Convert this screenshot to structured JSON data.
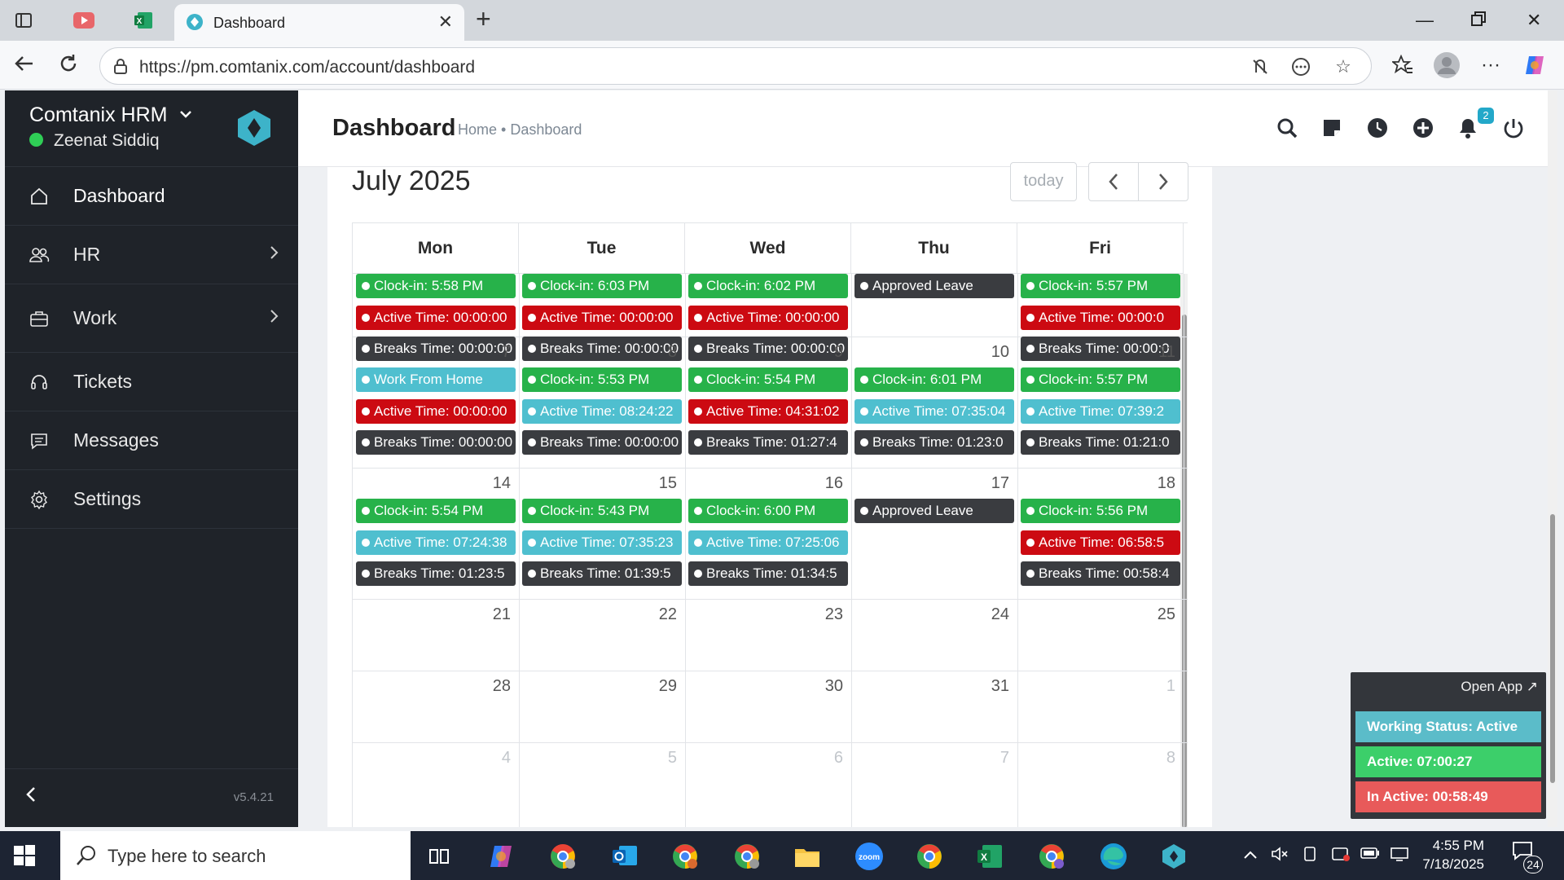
{
  "browser": {
    "tab_title": "Dashboard",
    "url": "https://pm.comtanix.com/account/dashboard"
  },
  "sidebar": {
    "brand": "Comtanix HRM",
    "user": "Zeenat Siddiq",
    "items": [
      {
        "label": "Dashboard",
        "icon": "home-icon"
      },
      {
        "label": "HR",
        "icon": "users-icon"
      },
      {
        "label": "Work",
        "icon": "briefcase-icon"
      },
      {
        "label": "Tickets",
        "icon": "headset-icon"
      },
      {
        "label": "Messages",
        "icon": "message-icon"
      },
      {
        "label": "Settings",
        "icon": "gear-icon"
      }
    ],
    "version": "v5.4.21"
  },
  "header": {
    "title": "Dashboard",
    "breadcrumb": [
      "Home",
      "Dashboard"
    ],
    "notification_count": "2"
  },
  "calendar": {
    "month_title": "July 2025",
    "today_label": "today",
    "days": [
      "Mon",
      "Tue",
      "Wed",
      "Thu",
      "Fri"
    ],
    "weeks": [
      {
        "nums": [
          "",
          "",
          "",
          "",
          ""
        ],
        "events": [
          [
            {
              "t": "Clock-in: 5:58 PM",
              "c": "green"
            },
            {
              "t": "Active Time: 00:00:00",
              "c": "red"
            },
            {
              "t": "Breaks Time: 00:00:00",
              "c": "dark"
            }
          ],
          [
            {
              "t": "Clock-in: 6:03 PM",
              "c": "green"
            },
            {
              "t": "Active Time: 00:00:00",
              "c": "red"
            },
            {
              "t": "Breaks Time: 00:00:00",
              "c": "dark"
            }
          ],
          [
            {
              "t": "Clock-in: 6:02 PM",
              "c": "green"
            },
            {
              "t": "Active Time: 00:00:00",
              "c": "red"
            },
            {
              "t": "Breaks Time: 00:00:00",
              "c": "dark"
            }
          ],
          [
            {
              "t": "Approved Leave",
              "c": "dark"
            }
          ],
          [
            {
              "t": "Clock-in: 5:57 PM",
              "c": "green"
            },
            {
              "t": "Active Time: 00:00:0",
              "c": "red"
            },
            {
              "t": "Breaks Time: 00:00:0",
              "c": "dark"
            }
          ]
        ]
      },
      {
        "nums": [
          "7",
          "8",
          "9",
          "10",
          "11"
        ],
        "events": [
          [
            {
              "t": "Work From Home",
              "c": "teal"
            },
            {
              "t": "Active Time: 00:00:00",
              "c": "red"
            },
            {
              "t": "Breaks Time: 00:00:00",
              "c": "dark"
            }
          ],
          [
            {
              "t": "Clock-in: 5:53 PM",
              "c": "green"
            },
            {
              "t": "Active Time: 08:24:22",
              "c": "teal"
            },
            {
              "t": "Breaks Time: 00:00:00",
              "c": "dark"
            }
          ],
          [
            {
              "t": "Clock-in: 5:54 PM",
              "c": "green"
            },
            {
              "t": "Active Time: 04:31:02",
              "c": "red"
            },
            {
              "t": "Breaks Time: 01:27:4",
              "c": "dark"
            }
          ],
          [
            {
              "t": "Clock-in: 6:01 PM",
              "c": "green"
            },
            {
              "t": "Active Time: 07:35:04",
              "c": "teal"
            },
            {
              "t": "Breaks Time: 01:23:0",
              "c": "dark"
            }
          ],
          [
            {
              "t": "Clock-in: 5:57 PM",
              "c": "green"
            },
            {
              "t": "Active Time: 07:39:2",
              "c": "teal"
            },
            {
              "t": "Breaks Time: 01:21:0",
              "c": "dark"
            }
          ]
        ]
      },
      {
        "nums": [
          "14",
          "15",
          "16",
          "17",
          "18"
        ],
        "events": [
          [
            {
              "t": "Clock-in: 5:54 PM",
              "c": "green"
            },
            {
              "t": "Active Time: 07:24:38",
              "c": "teal"
            },
            {
              "t": "Breaks Time: 01:23:5",
              "c": "dark"
            }
          ],
          [
            {
              "t": "Clock-in: 5:43 PM",
              "c": "green"
            },
            {
              "t": "Active Time: 07:35:23",
              "c": "teal"
            },
            {
              "t": "Breaks Time: 01:39:5",
              "c": "dark"
            }
          ],
          [
            {
              "t": "Clock-in: 6:00 PM",
              "c": "green"
            },
            {
              "t": "Active Time: 07:25:06",
              "c": "teal"
            },
            {
              "t": "Breaks Time: 01:34:5",
              "c": "dark"
            }
          ],
          [
            {
              "t": "Approved Leave",
              "c": "dark"
            }
          ],
          [
            {
              "t": "Clock-in: 5:56 PM",
              "c": "green"
            },
            {
              "t": "Active Time: 06:58:5",
              "c": "red"
            },
            {
              "t": "Breaks Time: 00:58:4",
              "c": "dark"
            }
          ]
        ]
      },
      {
        "nums": [
          "21",
          "22",
          "23",
          "24",
          "25"
        ],
        "events": [
          [],
          [],
          [],
          [],
          []
        ]
      },
      {
        "nums": [
          "28",
          "29",
          "30",
          "31",
          "1"
        ],
        "events": [
          [],
          [],
          [],
          [],
          []
        ]
      },
      {
        "nums": [
          "4",
          "5",
          "6",
          "7",
          "8"
        ],
        "events": [
          [],
          [],
          [],
          [],
          []
        ]
      }
    ]
  },
  "widget": {
    "open_app": "Open App ↗",
    "status": "Working Status: Active",
    "active": "Active: 07:00:27",
    "inactive": "In Active: 00:58:49"
  },
  "taskbar": {
    "search_placeholder": "Type here to search",
    "time": "4:55 PM",
    "date": "7/18/2025",
    "notification_count": "24"
  },
  "colors": {
    "green": "#27b24a",
    "red": "#cc0a12",
    "dark": "#3a3c40",
    "teal": "#4fbfcf",
    "sidebar": "#1f2329"
  }
}
